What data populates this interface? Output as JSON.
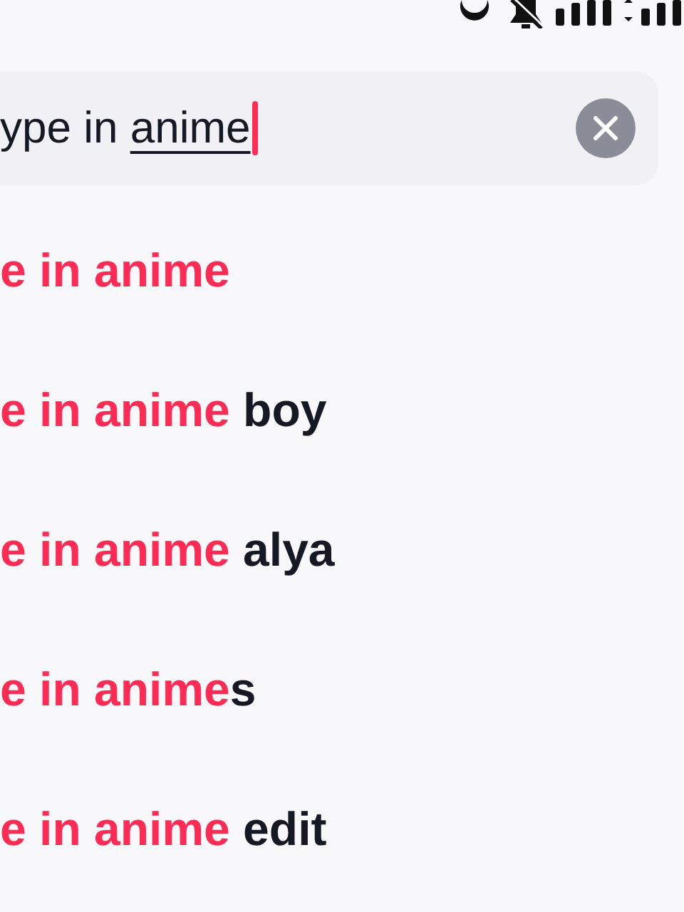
{
  "search": {
    "value": "ype in ",
    "composing": "anime",
    "focused": true
  },
  "suggestions": [
    {
      "match": "e in anime"
    },
    {
      "match": "e in anime",
      "rest": " boy"
    },
    {
      "match": "e in anime",
      "rest": " alya"
    },
    {
      "match": "e in anime",
      "rest": "s"
    },
    {
      "match": "e in anime",
      "rest": " edit"
    }
  ]
}
